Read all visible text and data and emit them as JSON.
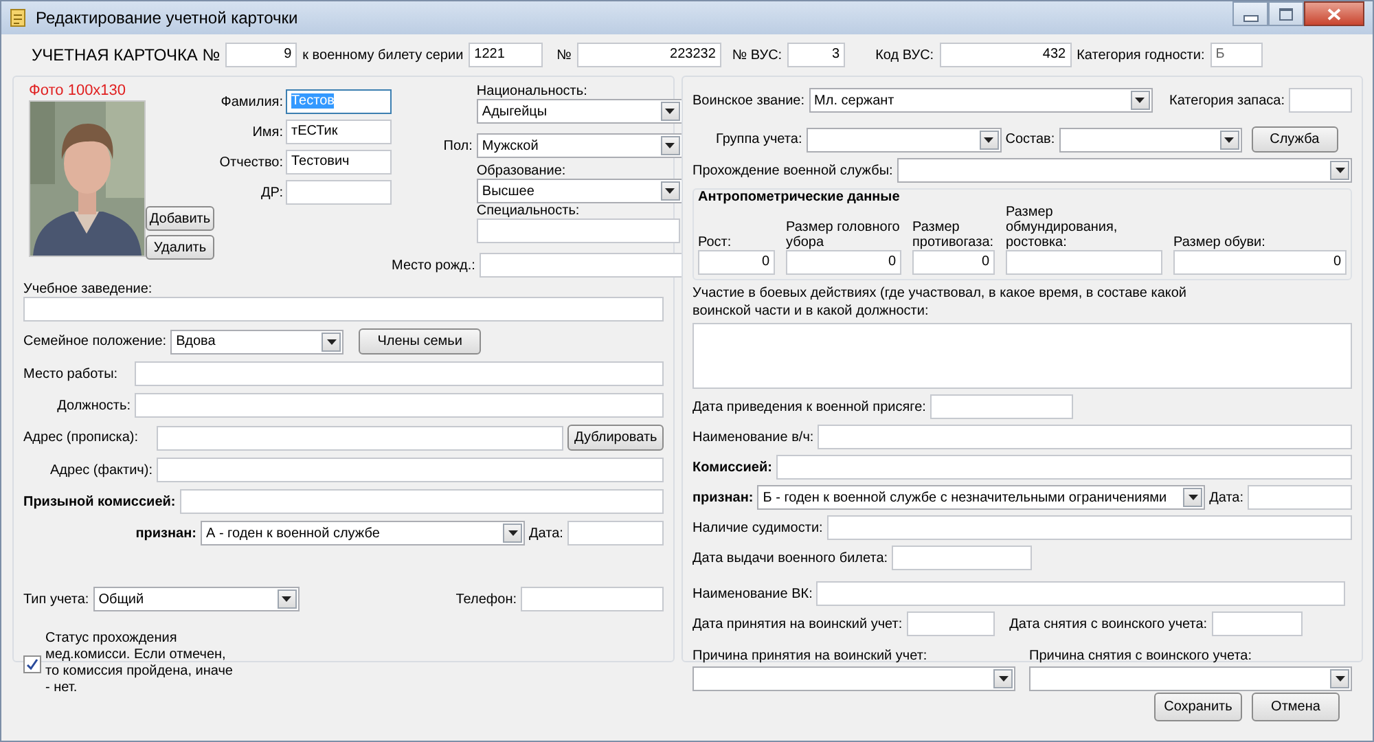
{
  "window": {
    "title": "Редактирование учетной карточки"
  },
  "header": [
    {
      "label": "УЧЕТНАЯ КАРТОЧКА №",
      "value": "9"
    },
    {
      "label": "к военному билету серии",
      "value": "1221"
    },
    {
      "label": "№",
      "value": "223232"
    },
    {
      "label": "№ ВУС:",
      "value": "3"
    },
    {
      "label": "Код ВУС:",
      "value": "432"
    },
    {
      "label": "Категория годности:",
      "value": "Б"
    }
  ],
  "photo": {
    "label": "Фото 100x130",
    "kind": "picture",
    "buttons": [
      "Добавить",
      "Удалить"
    ]
  },
  "name_fields": [
    {
      "label": "Фамилия:",
      "value": "Тестов",
      "highlighted": true
    },
    {
      "label": "Имя:",
      "value": "тЕСТик",
      "highlighted": false
    },
    {
      "label": "Отчество:",
      "value": "Тестович",
      "highlighted": false
    },
    {
      "label": "ДР:",
      "highlighted": false
    }
  ],
  "nationality": {
    "label": "Национальность:",
    "value": "Адыгейцы"
  },
  "gender": {
    "label": "Пол:",
    "value": "Мужской"
  },
  "education": {
    "label": "Образование:",
    "value": "Высшее"
  },
  "specialty": {
    "label": "Специальность:"
  },
  "birthplace": {
    "label": "Место рожд.:"
  },
  "school": {
    "label": "Учебное заведение:"
  },
  "marital": {
    "label": "Семейное положение:",
    "value": "Вдова",
    "button": "Члены семьи"
  },
  "workplace": {
    "label": "Место работы:"
  },
  "position": {
    "label": "Должность:"
  },
  "address_registered": {
    "label": "Адрес (прописка):",
    "button": "Дублировать"
  },
  "address_actual": {
    "label": "Адрес (фактич):"
  },
  "draft_commission": {
    "label": "Призыной комиссией:"
  },
  "draft_verdict": {
    "label": "признан:",
    "value": "А - годен к военной службе",
    "date_label": "Дата:"
  },
  "account_type": {
    "label": "Тип учета:",
    "value": "Общий"
  },
  "phone": {
    "label": "Телефон:"
  },
  "med_status": {
    "label": "Статус прохождения мед.комисси. Если отмечен, то комиссия пройдена, иначе - нет.",
    "checked": true
  },
  "rank": {
    "label": "Воинское звание:",
    "value": "Мл. сержант"
  },
  "reserve_category": {
    "label": "Категория запаса:"
  },
  "account_group": {
    "label": "Группа учета:"
  },
  "composition": {
    "label": "Состав:"
  },
  "service_button": "Служба",
  "service": {
    "label": "Прохождение военной службы:"
  },
  "anthropometry": {
    "title": "Антропометрические данные",
    "fields": [
      {
        "label": "Рост:",
        "value": "0"
      },
      {
        "label": "Размер головного убора",
        "value": "0"
      },
      {
        "label": "Размер противогаза:",
        "value": "0"
      },
      {
        "label": "Размер обмундирования, ростовка:"
      },
      {
        "label": "Размер обуви:",
        "value": "0"
      }
    ]
  },
  "combat": {
    "label": "Участие в боевых действиях (где участвовал, в какое время, в составе какой воинской части и в какой должности:"
  },
  "oath_date": {
    "label": "Дата приведения к военной присяге:"
  },
  "unit_name": {
    "label": "Наименование в/ч:"
  },
  "commission": {
    "label": "Комиссией:"
  },
  "verdict": {
    "label": "признан:",
    "value": "Б - годен к военной службе с незначительными ограничениями",
    "date_label": "Дата:"
  },
  "criminal_record": {
    "label": "Наличие судимости:"
  },
  "ticket_date": {
    "label": "Дата выдачи военного билета:"
  },
  "vk_name": {
    "label": "Наименование ВК:"
  },
  "registration": [
    {
      "label": "Дата принятия на воинский учет:"
    },
    {
      "label": "Дата снятия с воинского учета:"
    }
  ],
  "reasons": [
    {
      "label": "Причина принятия на воинский учет:"
    },
    {
      "label": "Причина снятия с воинского учета:"
    }
  ],
  "buttons": [
    "Сохранить",
    "Отмена"
  ]
}
